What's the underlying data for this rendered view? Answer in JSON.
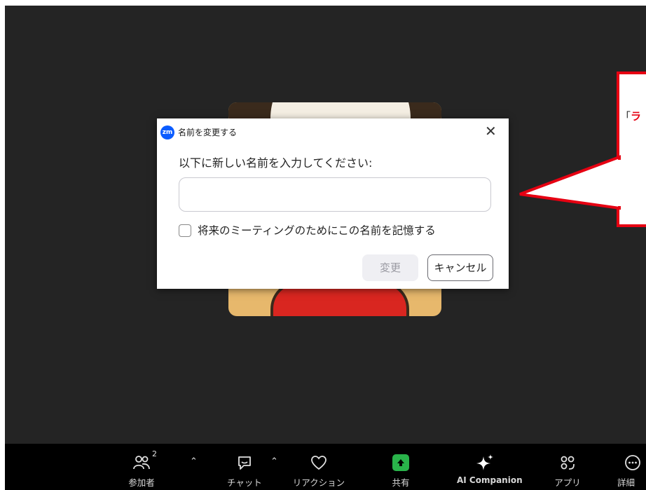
{
  "dialog": {
    "logo_text": "zm",
    "title": "名前を変更する",
    "close": "✕",
    "prompt": "以下に新しい名前を入力してください:",
    "input_value": "",
    "remember_label": "将来のミーティングのためにこの名前を記憶する",
    "remember_checked": false,
    "change_label": "変更",
    "cancel_label": "キャンセル"
  },
  "callout": {
    "text_prefix": "「",
    "text_highlight": "ラ",
    "highlight_color": "#e60012"
  },
  "toolbar": {
    "participants": {
      "label": "参加者",
      "count": "2",
      "icon": "participants-icon"
    },
    "chat": {
      "label": "チャット",
      "icon": "chat-icon"
    },
    "reactions": {
      "label": "リアクション",
      "icon": "heart-icon"
    },
    "share": {
      "label": "共有",
      "icon": "share-up-arrow-icon",
      "color": "#29b34a"
    },
    "ai_companion": {
      "label": "AI Companion",
      "icon": "sparkle-icon"
    },
    "apps": {
      "label": "アプリ",
      "icon": "apps-icon"
    },
    "more": {
      "label": "詳細",
      "icon": "more-icon"
    }
  },
  "colors": {
    "stage_bg": "#242424",
    "toolbar_bg": "#000000",
    "accent_red": "#e60012",
    "zoom_blue": "#0b5cff"
  }
}
